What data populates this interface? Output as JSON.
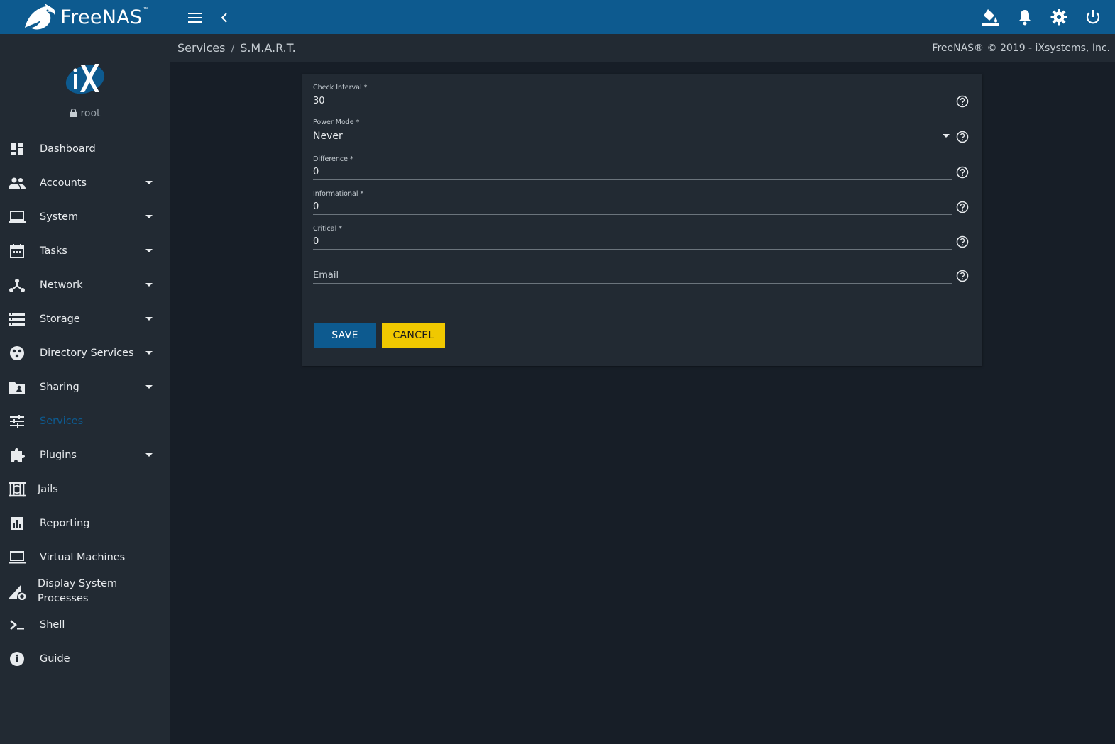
{
  "app": {
    "brand": "FreeNAS",
    "brand_tm": "™"
  },
  "user": {
    "name": "root"
  },
  "breadcrumb": {
    "parent": "Services",
    "separator": "/",
    "current": "S.M.A.R.T."
  },
  "copyright": "FreeNAS® © 2019 - iXsystems, Inc.",
  "nav": [
    {
      "label": "Dashboard",
      "icon": "dashboard-icon",
      "expandable": false
    },
    {
      "label": "Accounts",
      "icon": "people-icon",
      "expandable": true
    },
    {
      "label": "System",
      "icon": "laptop-icon",
      "expandable": true
    },
    {
      "label": "Tasks",
      "icon": "calendar-icon",
      "expandable": true
    },
    {
      "label": "Network",
      "icon": "network-icon",
      "expandable": true
    },
    {
      "label": "Storage",
      "icon": "storage-icon",
      "expandable": true
    },
    {
      "label": "Directory Services",
      "icon": "directory-icon",
      "expandable": true
    },
    {
      "label": "Sharing",
      "icon": "folder-shared-icon",
      "expandable": true
    },
    {
      "label": "Services",
      "icon": "tune-icon",
      "expandable": false,
      "active": true
    },
    {
      "label": "Plugins",
      "icon": "puzzle-icon",
      "expandable": true
    },
    {
      "label": "Jails",
      "icon": "jail-icon",
      "expandable": false
    },
    {
      "label": "Reporting",
      "icon": "chart-icon",
      "expandable": false
    },
    {
      "label": "Virtual Machines",
      "icon": "laptop-icon",
      "expandable": false
    },
    {
      "label": "Display System Processes",
      "icon": "processes-icon",
      "expandable": false
    },
    {
      "label": "Shell",
      "icon": "terminal-icon",
      "expandable": false
    },
    {
      "label": "Guide",
      "icon": "info-icon",
      "expandable": false
    }
  ],
  "form": {
    "check_interval": {
      "label": "Check Interval *",
      "value": "30"
    },
    "power_mode": {
      "label": "Power Mode *",
      "value": "Never"
    },
    "difference": {
      "label": "Difference *",
      "value": "0"
    },
    "informational": {
      "label": "Informational *",
      "value": "0"
    },
    "critical": {
      "label": "Critical *",
      "value": "0"
    },
    "email": {
      "placeholder": "Email",
      "value": ""
    },
    "save_label": "SAVE",
    "cancel_label": "CANCEL"
  },
  "colors": {
    "topbar": "#0d5a8f",
    "sidebar": "#222a33",
    "background": "#171e27",
    "save": "#0d5a8f",
    "cancel": "#f0c800"
  }
}
